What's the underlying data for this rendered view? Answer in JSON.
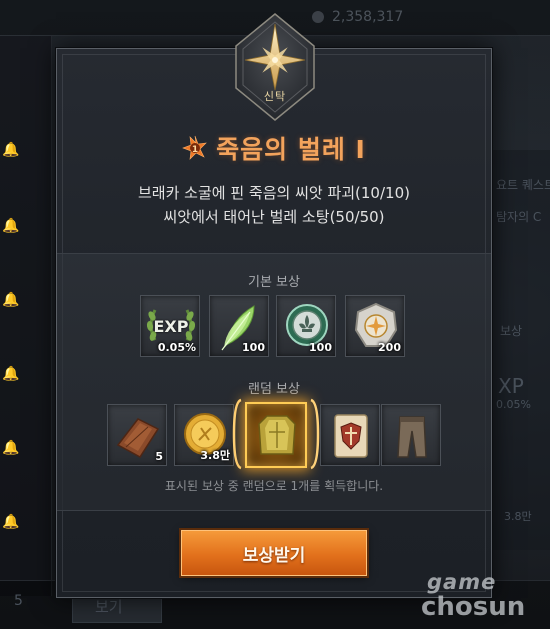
{
  "background": {
    "currency_amount": "2,358,317",
    "bottom_left_count": "5",
    "bottom_button_label": "보기",
    "right_panel_texts": [
      "요트 퀘스트",
      "탐자의 C",
      "보상",
      "XP",
      "0.05%",
      "3.8만"
    ]
  },
  "modal": {
    "emblem_label": "신탁",
    "title": "죽음의 벌레 Ⅰ",
    "title_badge_number": "1",
    "objectives": [
      "브래카 소굴에 핀 죽음의 씨앗 파괴(10/10)",
      "씨앗에서 태어난 벌레 소탕(50/50)"
    ],
    "basic_rewards": {
      "label": "기본 보상",
      "items": [
        {
          "icon": "exp-laurel-icon",
          "badge": "EXP",
          "quantity": "0.05%"
        },
        {
          "icon": "green-feather-icon",
          "quantity": "100"
        },
        {
          "icon": "fleur-de-lis-coin-icon",
          "quantity": "100"
        },
        {
          "icon": "compass-shield-icon",
          "quantity": "200"
        }
      ]
    },
    "random_rewards": {
      "label": "랜덤 보상",
      "items": [
        {
          "icon": "leather-scroll-icon",
          "quantity": "5"
        },
        {
          "icon": "gold-coin-icon",
          "quantity": "3.8만"
        },
        {
          "icon": "golden-armor-icon",
          "quantity": "",
          "selected": true
        },
        {
          "icon": "parchment-shield-icon",
          "quantity": ""
        },
        {
          "icon": "leather-pants-icon",
          "quantity": ""
        }
      ],
      "note": "표시된 보상 중 랜덤으로 1개를 획득합니다."
    },
    "claim_button_label": "보상받기"
  },
  "watermark": {
    "line1": "game",
    "line2": "chosun"
  },
  "colors": {
    "title": "#f3a35c",
    "accent_orange": "#e2711c",
    "selected_glow": "#ffcc55"
  }
}
